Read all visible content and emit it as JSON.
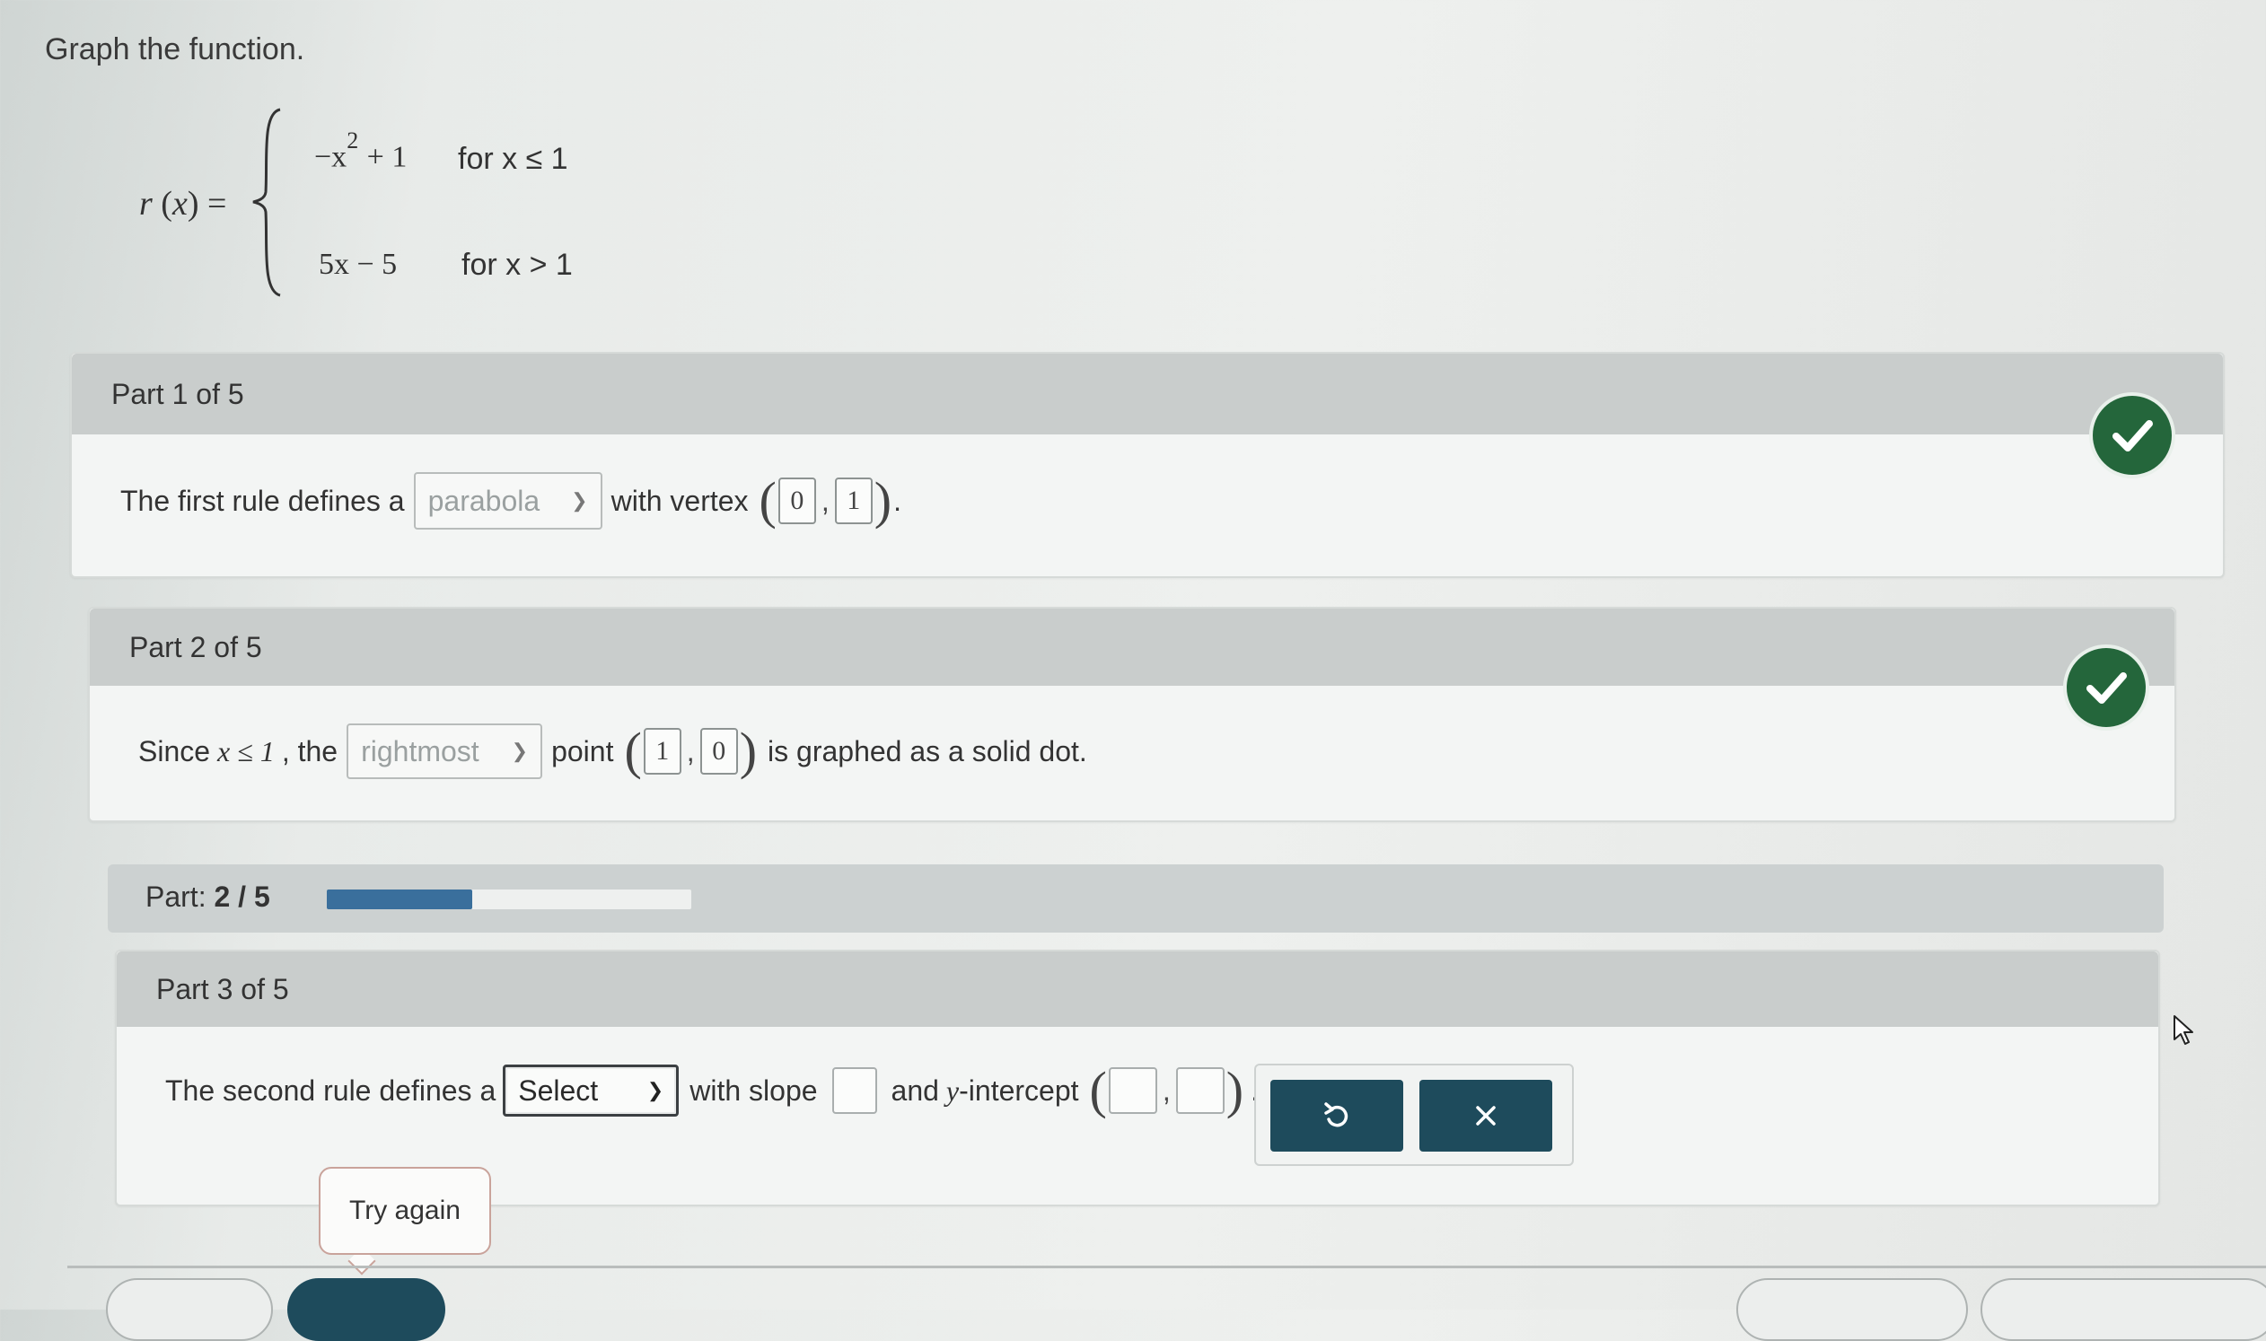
{
  "instruction": "Graph the function.",
  "function": {
    "name": "r",
    "var": "x",
    "pieces": [
      {
        "expr_prefix": "−x",
        "expr_exp": "2",
        "expr_suffix": "+ 1",
        "condition": "for x ≤ 1"
      },
      {
        "expr": "5x − 5",
        "condition": "for x > 1"
      }
    ]
  },
  "parts": [
    {
      "header": "Part 1 of 5",
      "text_before": "The first rule defines a",
      "dropdown_value": "parabola",
      "text_after": "with vertex",
      "coords": [
        "0",
        "1"
      ],
      "tail": ".",
      "status": "correct"
    },
    {
      "header": "Part 2 of 5",
      "text_since": "Since",
      "math": "x ≤ 1",
      "text_comma": ", the",
      "dropdown_value": "rightmost",
      "text_point": "point",
      "coords": [
        "1",
        "0"
      ],
      "tail": "is graphed as a solid dot.",
      "status": "correct"
    },
    {
      "header": "Part 3 of 5",
      "text_before": "The second rule defines a",
      "dropdown_value": "Select",
      "text_slope": "with slope",
      "text_and": "and",
      "text_intercept_var": "y",
      "text_intercept": "-intercept",
      "tail": "."
    }
  ],
  "progress": {
    "label": "Part:",
    "value": "2 / 5",
    "fraction": 0.4
  },
  "buttons": {
    "undo_icon": "undo-icon",
    "clear_icon": "x-icon",
    "try_again": "Try again"
  },
  "colors": {
    "check": "#24663b",
    "action_button": "#1e4b5c",
    "progress_fill": "#3a6f9c"
  }
}
